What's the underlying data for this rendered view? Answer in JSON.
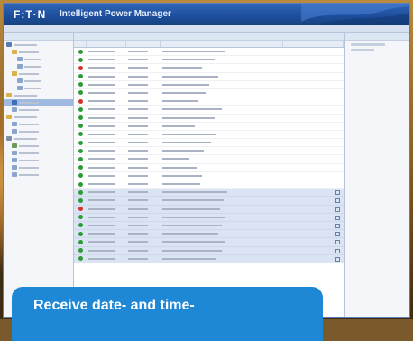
{
  "window": {
    "logo": "F:T·N",
    "title": "Intelligent Power Manager"
  },
  "callout": {
    "text": "Receive date- and time-"
  },
  "colors": {
    "status_ok": "#2e9a3a",
    "status_alarm": "#d0342c",
    "highlight_row": "#dbe4f2",
    "callout_bg": "#1e88d6"
  },
  "tree": {
    "items": [
      {
        "indent": 0,
        "icon": "server-icon",
        "selected": false
      },
      {
        "indent": 1,
        "icon": "folder-icon",
        "selected": false
      },
      {
        "indent": 2,
        "icon": "device-icon",
        "selected": false
      },
      {
        "indent": 2,
        "icon": "device-icon",
        "selected": false
      },
      {
        "indent": 1,
        "icon": "folder-icon",
        "selected": false
      },
      {
        "indent": 2,
        "icon": "device-icon",
        "selected": false
      },
      {
        "indent": 2,
        "icon": "device-icon",
        "selected": false
      },
      {
        "indent": 0,
        "icon": "folder-icon",
        "selected": false
      },
      {
        "indent": 1,
        "icon": "event-log-icon",
        "selected": true
      },
      {
        "indent": 1,
        "icon": "device-icon",
        "selected": false
      },
      {
        "indent": 0,
        "icon": "folder-icon",
        "selected": false
      },
      {
        "indent": 1,
        "icon": "device-icon",
        "selected": false
      },
      {
        "indent": 1,
        "icon": "device-icon",
        "selected": false
      },
      {
        "indent": 0,
        "icon": "settings-icon",
        "selected": false
      },
      {
        "indent": 1,
        "icon": "user-icon",
        "selected": false
      },
      {
        "indent": 1,
        "icon": "device-icon",
        "selected": false
      },
      {
        "indent": 1,
        "icon": "device-icon",
        "selected": false
      },
      {
        "indent": 1,
        "icon": "device-icon",
        "selected": false
      },
      {
        "indent": 1,
        "icon": "device-icon",
        "selected": false
      }
    ]
  },
  "events": {
    "rows": [
      {
        "status": "ok",
        "highlight": false,
        "ack": false
      },
      {
        "status": "ok",
        "highlight": false,
        "ack": false
      },
      {
        "status": "alarm",
        "highlight": false,
        "ack": false
      },
      {
        "status": "ok",
        "highlight": false,
        "ack": false
      },
      {
        "status": "ok",
        "highlight": false,
        "ack": false
      },
      {
        "status": "ok",
        "highlight": false,
        "ack": false
      },
      {
        "status": "alarm",
        "highlight": false,
        "ack": false
      },
      {
        "status": "ok",
        "highlight": false,
        "ack": false
      },
      {
        "status": "ok",
        "highlight": false,
        "ack": false
      },
      {
        "status": "ok",
        "highlight": false,
        "ack": false
      },
      {
        "status": "ok",
        "highlight": false,
        "ack": false
      },
      {
        "status": "ok",
        "highlight": false,
        "ack": false
      },
      {
        "status": "ok",
        "highlight": false,
        "ack": false
      },
      {
        "status": "ok",
        "highlight": false,
        "ack": false
      },
      {
        "status": "ok",
        "highlight": false,
        "ack": false
      },
      {
        "status": "ok",
        "highlight": false,
        "ack": false
      },
      {
        "status": "ok",
        "highlight": false,
        "ack": false
      },
      {
        "status": "ok",
        "highlight": true,
        "ack": true
      },
      {
        "status": "ok",
        "highlight": true,
        "ack": true
      },
      {
        "status": "alarm",
        "highlight": true,
        "ack": true
      },
      {
        "status": "ok",
        "highlight": true,
        "ack": true
      },
      {
        "status": "ok",
        "highlight": true,
        "ack": true
      },
      {
        "status": "ok",
        "highlight": true,
        "ack": true
      },
      {
        "status": "ok",
        "highlight": true,
        "ack": true
      },
      {
        "status": "ok",
        "highlight": true,
        "ack": true
      },
      {
        "status": "ok",
        "highlight": true,
        "ack": true
      }
    ]
  }
}
